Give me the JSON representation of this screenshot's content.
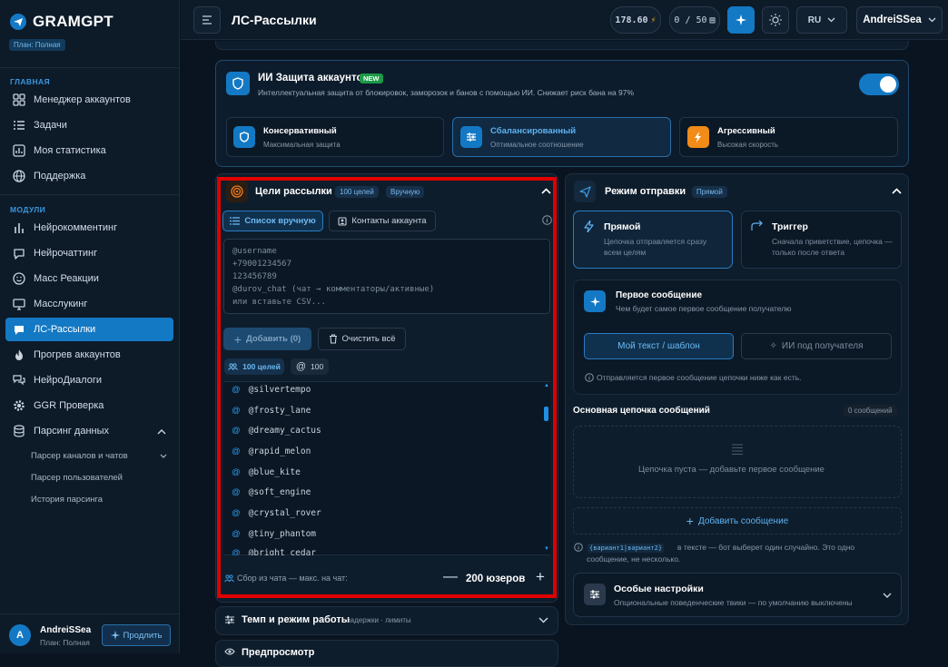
{
  "app": {
    "name": "GRAMGPT",
    "plan": "План: Полная"
  },
  "sidebar": {
    "section_main": "ГЛАВНАЯ",
    "main_items": [
      {
        "label": "Менеджер аккаунтов",
        "icon": "grid-icon"
      },
      {
        "label": "Задачи",
        "icon": "list-icon"
      },
      {
        "label": "Моя статистика",
        "icon": "chart-icon"
      },
      {
        "label": "Поддержка",
        "icon": "globe-icon"
      }
    ],
    "section_modules": "МОДУЛИ",
    "module_items": [
      {
        "label": "Нейрокомментинг",
        "icon": "bars-icon"
      },
      {
        "label": "Нейрочаттинг",
        "icon": "chat-icon"
      },
      {
        "label": "Масс Реакции",
        "icon": "smile-icon"
      },
      {
        "label": "Масслукинг",
        "icon": "monitor-icon"
      },
      {
        "label": "ЛС-Рассылки",
        "icon": "send-icon",
        "active": true
      },
      {
        "label": "Прогрев аккаунтов",
        "icon": "flame-icon"
      },
      {
        "label": "НейроДиалоги",
        "icon": "dialog-icon"
      },
      {
        "label": "GGR Проверка",
        "icon": "gear-icon"
      },
      {
        "label": "Парсинг данных",
        "icon": "database-icon"
      }
    ],
    "parsing_sub": [
      "Парсер каналов и чатов",
      "Парсер пользователей",
      "История парсинга"
    ],
    "user": {
      "name": "AndreiSSea",
      "plan": "План: Полная",
      "initial": "A"
    },
    "extend_label": "Продлить"
  },
  "header": {
    "title": "ЛС-Рассылки",
    "balance": "178.60",
    "messages": "0 / 50",
    "language": "RU",
    "user": "AndreiSSea"
  },
  "protection": {
    "title": "ИИ Защита аккаунтов",
    "new_badge": "NEW",
    "desc": "Интеллектуальная защита от блокировок, заморозок и банов с помощью ИИ. Снижает риск бана на 97%",
    "enabled": true,
    "modes": [
      {
        "title": "Консервативный",
        "subtitle": "Максимальная защита"
      },
      {
        "title": "Сбалансированный",
        "subtitle": "Оптимальное соотношение",
        "selected": true
      },
      {
        "title": "Агрессивный",
        "subtitle": "Высокая скорость"
      }
    ]
  },
  "targets": {
    "title": "Цели рассылки",
    "count_badge": "100 целей",
    "mode_badge": "Вручную",
    "tab_manual": "Список вручную",
    "tab_contacts": "Контакты аккаунта",
    "textarea_lines": [
      "@username",
      "+79001234567",
      "123456789",
      "@durov_chat (чат → комментаторы/активные)",
      "или вставьте CSV..."
    ],
    "add_label": "Добавить (0)",
    "clear_label": "Очистить всё",
    "stat_targets": "100 целей",
    "stat_at": "100",
    "usernames": [
      "@silvertempo",
      "@frosty_lane",
      "@dreamy_cactus",
      "@rapid_melon",
      "@blue_kite",
      "@soft_engine",
      "@crystal_rover",
      "@tiny_phantom",
      "@bright_cedar"
    ],
    "collect_label": "Сбор из чата — макс. на чат:",
    "collect_value": "200 юзеров"
  },
  "send_mode": {
    "title": "Режим отправки",
    "badge": "Прямой",
    "direct": {
      "title": "Прямой",
      "desc": "Цепочка отправляется сразу всем целям"
    },
    "trigger": {
      "title": "Триггер",
      "desc": "Сначала приветствие, цепочка — только после ответа"
    },
    "first_msg_title": "Первое сообщение",
    "first_msg_desc": "Чем будет самое первое сообщение получателю",
    "my_text": "Мой текст / шаблон",
    "ai_text": "ИИ под получателя",
    "first_note": "Отправляется первое сообщение цепочки ниже как есть.",
    "chain_title": "Основная цепочка сообщений",
    "chain_count": "0 сообщений",
    "chain_empty": "Цепочка пуста — добавьте первое сообщение",
    "add_message": "Добавить сообщение",
    "variant_tag": "{вариант1|вариант2}",
    "variant_note1": "в тексте — бот выберет один случайно. Это одно",
    "variant_note2": "сообщение, не несколько.",
    "special_title": "Особые настройки",
    "special_desc": "Опциональные поведенческие твики — по умолчанию выключены"
  },
  "tempo": {
    "title": "Темп и режим работы",
    "subtitle": "задержки · лимиты"
  },
  "preview": {
    "title": "Предпросмотр"
  },
  "colors": {
    "accent": "#1479c4",
    "highlight": "#e00000",
    "background": "#0a1420"
  }
}
